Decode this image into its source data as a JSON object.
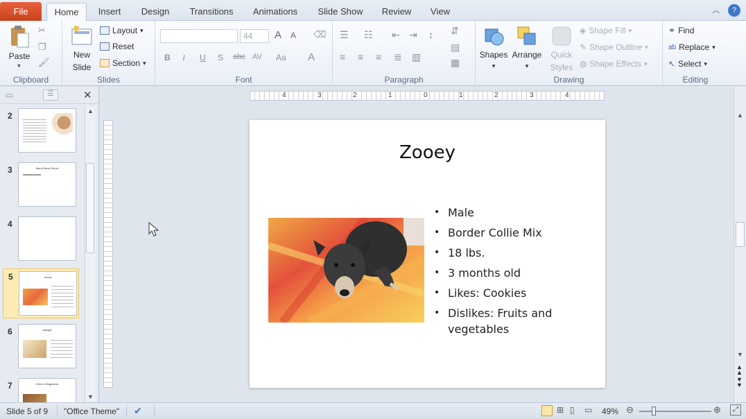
{
  "tabs": {
    "file": "File",
    "items": [
      "Home",
      "Insert",
      "Design",
      "Transitions",
      "Animations",
      "Slide Show",
      "Review",
      "View"
    ],
    "active": "Home"
  },
  "ribbon": {
    "clipboard": {
      "label": "Clipboard",
      "paste": "Paste"
    },
    "slides": {
      "label": "Slides",
      "new_slide_line1": "New",
      "new_slide_line2": "Slide",
      "layout": "Layout",
      "reset": "Reset",
      "section": "Section"
    },
    "font": {
      "label": "Font",
      "font_name": "",
      "font_size": "44",
      "bold": "B",
      "italic": "I",
      "underline": "U",
      "shadow": "S",
      "strike": "abc",
      "spacing": "AV",
      "case": "Aa",
      "grow": "A",
      "shrink": "A",
      "color": "A"
    },
    "paragraph": {
      "label": "Paragraph"
    },
    "drawing": {
      "label": "Drawing",
      "shapes": "Shapes",
      "arrange": "Arrange",
      "quick_styles_line1": "Quick",
      "quick_styles_line2": "Styles",
      "shape_fill": "Shape Fill",
      "shape_outline": "Shape Outline",
      "shape_effects": "Shape Effects"
    },
    "editing": {
      "label": "Editing",
      "find": "Find",
      "replace": "Replace",
      "select": "Select"
    }
  },
  "thumbnails": [
    {
      "num": "2",
      "title": ""
    },
    {
      "num": "3",
      "title": "Man's Best Friend"
    },
    {
      "num": "4",
      "title": ""
    },
    {
      "num": "5",
      "title": "Zooey",
      "selected": true
    },
    {
      "num": "6",
      "title": "Jalinger"
    },
    {
      "num": "7",
      "title": "Oliver & Bagheera"
    }
  ],
  "ruler": {
    "labels": [
      "4",
      "3",
      "2",
      "1",
      "0",
      "1",
      "2",
      "3",
      "4"
    ]
  },
  "slide": {
    "title": "Zooey",
    "bullets": [
      "Male",
      "Border Collie Mix",
      "18 lbs.",
      "3 months old",
      "Likes: Cookies",
      "Dislikes: Fruits and vegetables"
    ]
  },
  "status": {
    "slide_info": "Slide 5 of 9",
    "theme": "\"Office Theme\"",
    "zoom": "49%"
  },
  "colors": {
    "file_tab": "#d24b26",
    "selected_thumb": "#fcebb2",
    "ribbon_bg": "#f3f6fa"
  }
}
